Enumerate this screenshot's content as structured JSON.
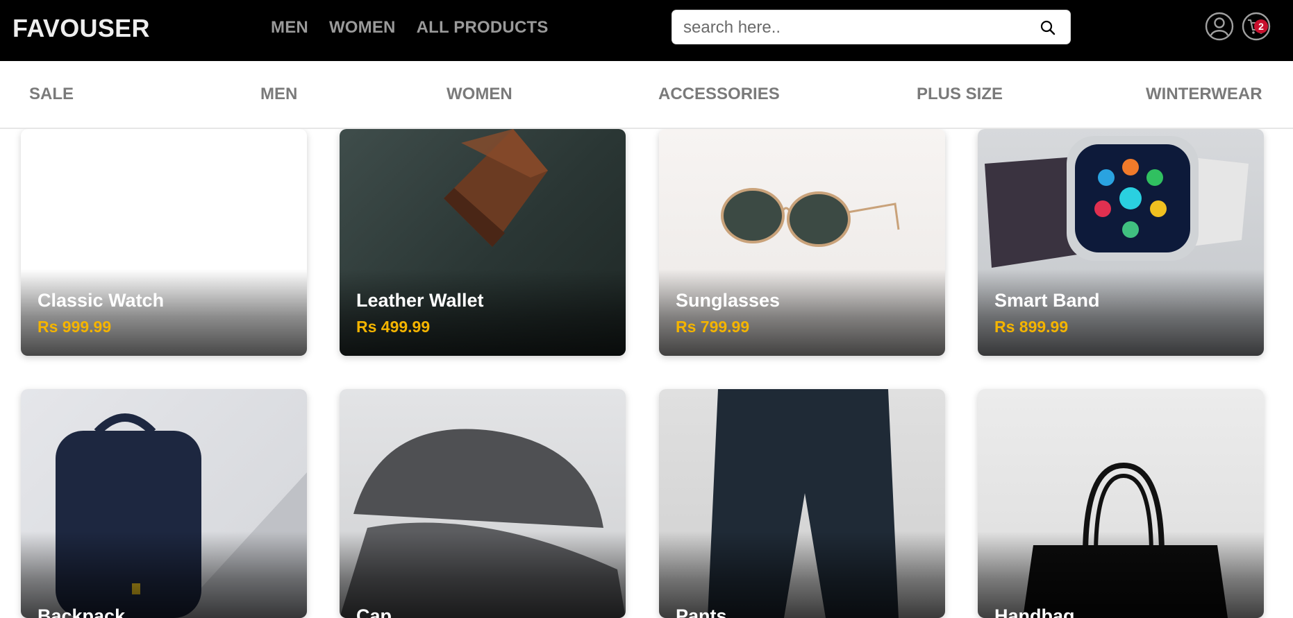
{
  "header": {
    "logo": "FAVOUSER",
    "nav": [
      "MEN",
      "WOMEN",
      "ALL PRODUCTS"
    ],
    "search_placeholder": "search here..",
    "cart_count": "2",
    "icons": [
      "search-icon",
      "user-icon",
      "cart-icon"
    ]
  },
  "categories": [
    "SALE",
    "MEN",
    "WOMEN",
    "ACCESSORIES",
    "PLUS SIZE",
    "WINTERWEAR"
  ],
  "products": [
    {
      "name": "Classic Watch",
      "price": "Rs 999.99"
    },
    {
      "name": "Leather Wallet",
      "price": "Rs 499.99"
    },
    {
      "name": "Sunglasses",
      "price": "Rs 799.99"
    },
    {
      "name": "Smart Band",
      "price": "Rs 899.99"
    },
    {
      "name": "Backpack",
      "price": ""
    },
    {
      "name": "Cap",
      "price": ""
    },
    {
      "name": "Pants",
      "price": ""
    },
    {
      "name": "Handbag",
      "price": ""
    }
  ],
  "colors": {
    "header_bg": "#000000",
    "price": "#f4b400",
    "badge": "#c8102e",
    "nav_text": "#9a9a9a"
  }
}
